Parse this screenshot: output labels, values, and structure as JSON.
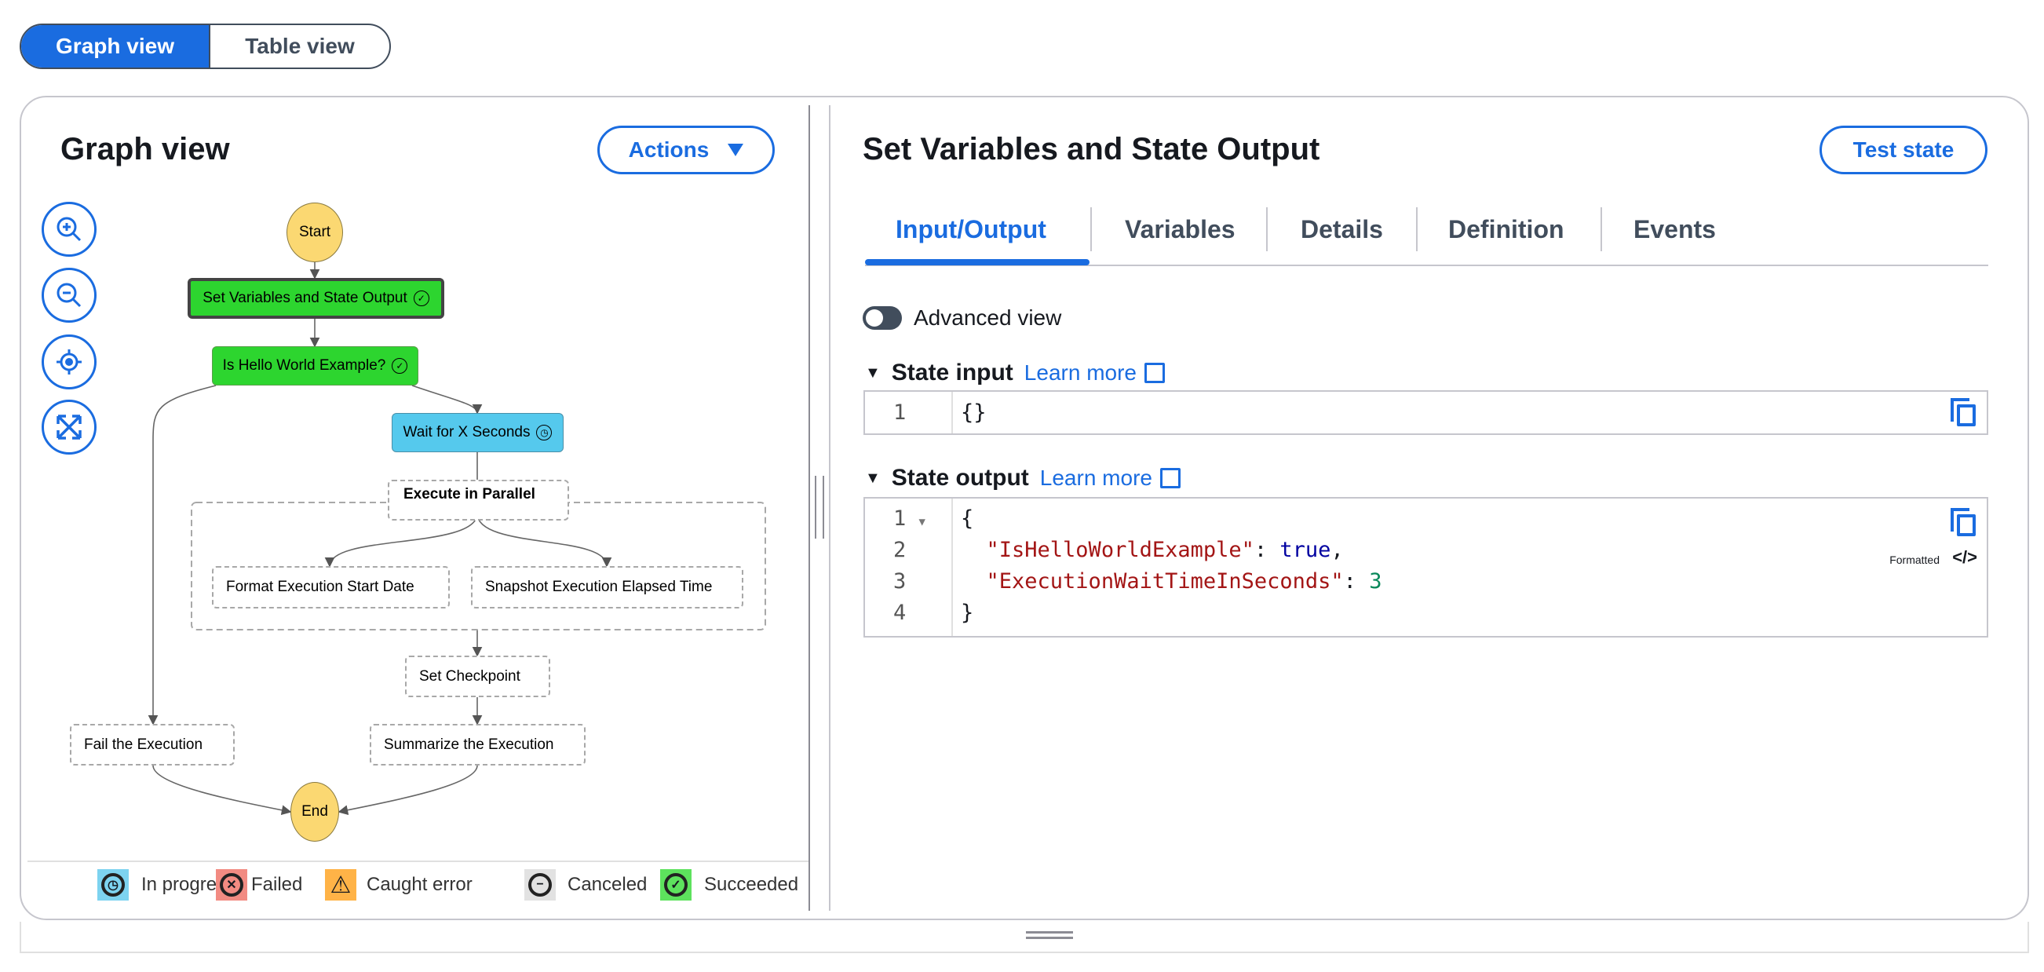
{
  "view_toggle": {
    "graph": "Graph view",
    "table": "Table view",
    "selected": "Graph view"
  },
  "graph_panel": {
    "title": "Graph view",
    "actions_label": "Actions",
    "zoom_controls": [
      "zoom-in-icon",
      "zoom-out-icon",
      "center-icon",
      "fit-icon"
    ],
    "nodes": {
      "start": "Start",
      "set_vars": "Set Variables and State Output",
      "is_hello": "Is Hello World Example?",
      "wait": "Wait for X Seconds",
      "parallel": "Execute in Parallel",
      "format": "Format Execution Start Date",
      "snapshot": "Snapshot Execution Elapsed Time",
      "checkpoint": "Set Checkpoint",
      "fail": "Fail the Execution",
      "summarize": "Summarize the Execution",
      "end": "End"
    },
    "node_status": {
      "set_vars": "succeeded",
      "is_hello": "succeeded",
      "wait": "in progress"
    },
    "legend": [
      {
        "label": "In progress",
        "color": "#7dd3f0"
      },
      {
        "label": "Failed",
        "color": "#f28b82"
      },
      {
        "label": "Caught error",
        "color": "#ffb347"
      },
      {
        "label": "Canceled",
        "color": "#e2e2e2"
      },
      {
        "label": "Succeeded",
        "color": "#5de25d"
      }
    ]
  },
  "detail_panel": {
    "title": "Set Variables and State Output",
    "test_state_label": "Test state",
    "tabs": [
      "Input/Output",
      "Variables",
      "Details",
      "Definition",
      "Events"
    ],
    "active_tab": "Input/Output",
    "advanced_view": {
      "label": "Advanced view",
      "enabled": false
    },
    "state_input": {
      "heading": "State input",
      "learn_more": "Learn more",
      "lines": [
        "{}"
      ]
    },
    "state_output": {
      "heading": "State output",
      "learn_more": "Learn more",
      "format_label": "Formatted",
      "lines": {
        "l1": "{",
        "l2_key": "\"IsHelloWorldExample\"",
        "l2_val": "true",
        "l3_key": "\"ExecutionWaitTimeInSeconds\"",
        "l3_val": "3",
        "l4": "}"
      }
    }
  },
  "colors": {
    "accent": "#1a6ce0",
    "succeeded": "#2dd52f",
    "in_progress": "#55c9ed",
    "start_end": "#fbd872"
  }
}
